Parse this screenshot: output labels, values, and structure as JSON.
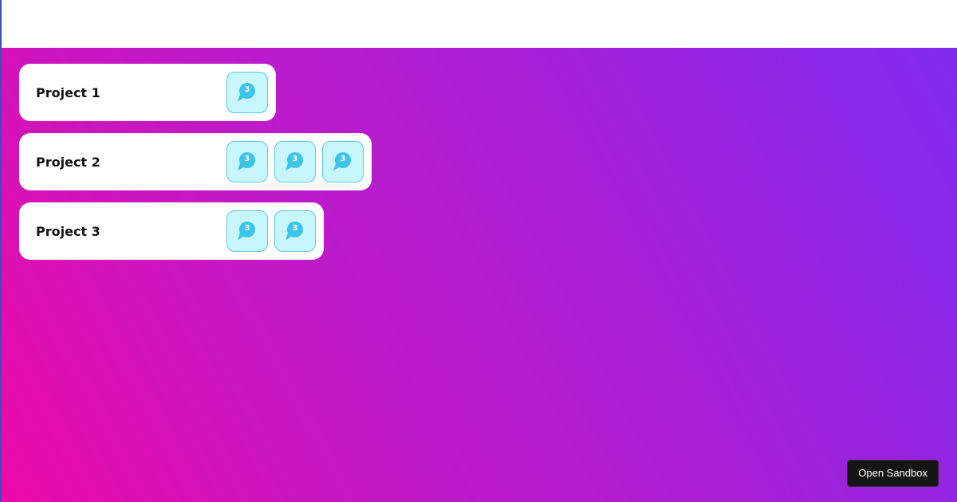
{
  "projects": [
    {
      "title": "Project 1",
      "chips": [
        {
          "count": "3",
          "icon": "chat-bubble-icon"
        }
      ]
    },
    {
      "title": "Project 2",
      "chips": [
        {
          "count": "3",
          "icon": "chat-bubble-icon"
        },
        {
          "count": "3",
          "icon": "chat-bubble-icon"
        },
        {
          "count": "3",
          "icon": "chat-bubble-icon"
        }
      ]
    },
    {
      "title": "Project 3",
      "chips": [
        {
          "count": "3",
          "icon": "chat-bubble-icon"
        },
        {
          "count": "3",
          "icon": "chat-bubble-icon"
        }
      ]
    }
  ],
  "sandbox_button": {
    "label": "Open Sandbox"
  },
  "colors": {
    "gradient_start": "#ec0aa8",
    "gradient_end": "#7f2af0",
    "chip_bg": "#c8f6fd",
    "chip_border": "#5cc8ea",
    "chip_icon": "#3ec3ea",
    "button_bg": "#151515"
  }
}
